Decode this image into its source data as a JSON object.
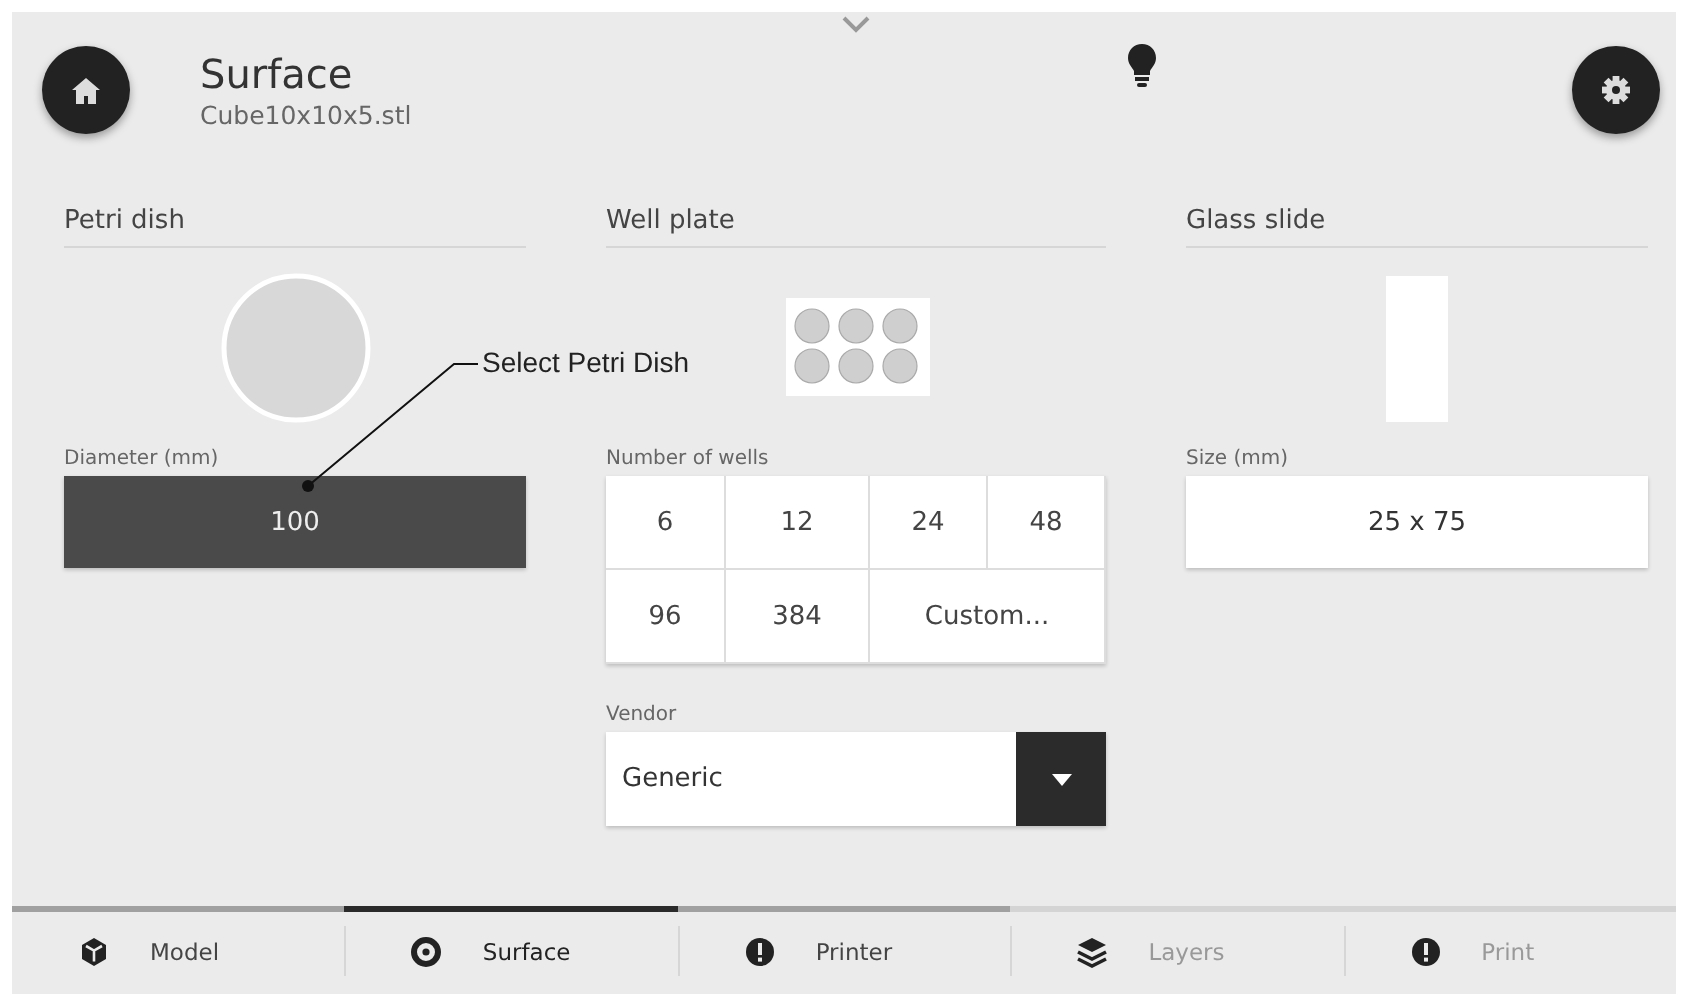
{
  "header": {
    "title": "Surface",
    "subtitle": "Cube10x10x5.stl"
  },
  "columns": [
    {
      "kind": "petri",
      "heading": "Petri dish",
      "field_label": "Diameter (mm)",
      "value": "100",
      "selected": true
    },
    {
      "kind": "wells",
      "heading": "Well plate",
      "field_label": "Number of wells",
      "options": [
        {
          "label": "6",
          "kind": "number",
          "selected": false
        },
        {
          "label": "12",
          "kind": "number",
          "selected": false
        },
        {
          "label": "24",
          "kind": "number",
          "selected": false
        },
        {
          "label": "48",
          "kind": "number",
          "selected": false
        },
        {
          "label": "96",
          "kind": "number",
          "selected": false
        },
        {
          "label": "384",
          "kind": "number",
          "selected": false
        },
        {
          "label": "Custom...",
          "kind": "custom",
          "selected": false
        }
      ],
      "vendor_label": "Vendor",
      "vendor": "Generic",
      "selected": false
    },
    {
      "kind": "slide",
      "heading": "Glass slide",
      "field_label": "Size (mm)",
      "value": "25 x 75",
      "selected": false
    }
  ],
  "annotation": {
    "text": "Select Petri Dish"
  },
  "progress": {
    "level": 0.6
  },
  "steps": [
    {
      "label": "Model",
      "kind": "cube",
      "selected": false,
      "disabled": false
    },
    {
      "label": "Surface",
      "kind": "ring",
      "selected": true,
      "disabled": false
    },
    {
      "label": "Printer",
      "kind": "alert",
      "selected": false,
      "disabled": false
    },
    {
      "label": "Layers",
      "kind": "layers",
      "selected": false,
      "disabled": true
    },
    {
      "label": "Print",
      "kind": "alert",
      "selected": false,
      "disabled": true
    }
  ]
}
